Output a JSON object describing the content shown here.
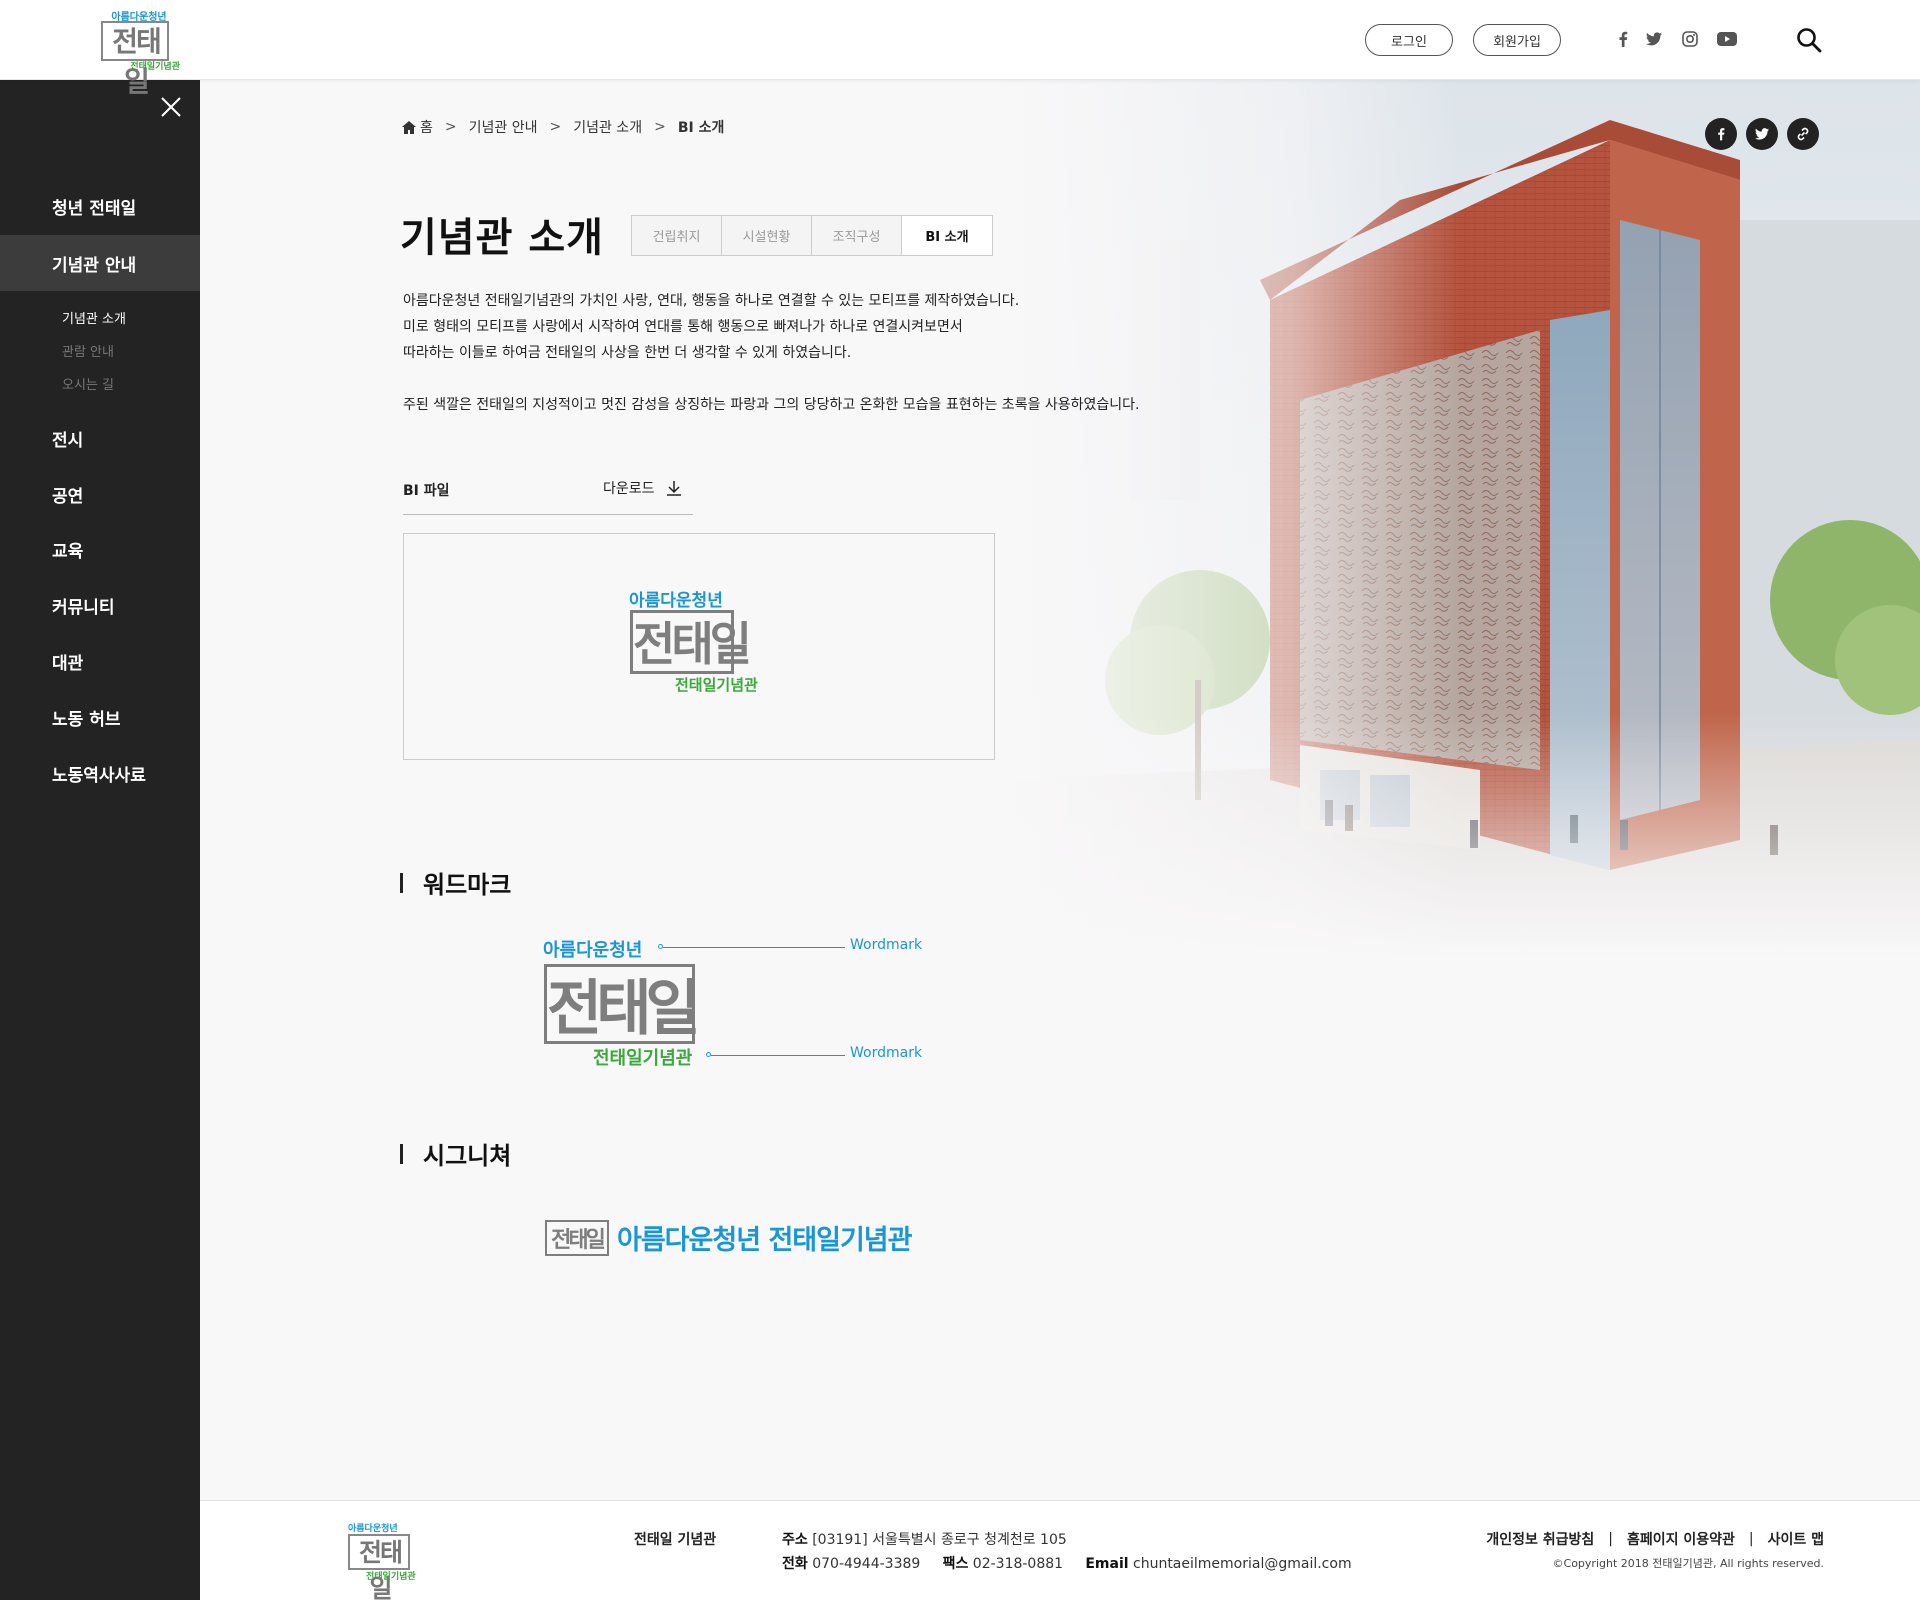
{
  "header": {
    "logo": {
      "top": "아름다운청년",
      "main": "전태일",
      "bottom": "전태일기념관"
    },
    "login_label": "로그인",
    "join_label": "회원가입",
    "sns": [
      "facebook-icon",
      "twitter-icon",
      "instagram-icon",
      "youtube-icon"
    ],
    "search_icon": "search-icon"
  },
  "sidebar": {
    "items": [
      {
        "label": "청년 전태일"
      },
      {
        "label": "기념관 안내"
      },
      {
        "label": "전시"
      },
      {
        "label": "공연"
      },
      {
        "label": "교육"
      },
      {
        "label": "커뮤니티"
      },
      {
        "label": "대관"
      },
      {
        "label": "노동 허브"
      },
      {
        "label": "노동역사사료"
      }
    ],
    "sub_items": [
      {
        "label": "기념관 소개"
      },
      {
        "label": "관람 안내"
      },
      {
        "label": "오시는 길"
      }
    ]
  },
  "breadcrumb": {
    "home": "홈",
    "sep": ">",
    "level1": "기념관 안내",
    "level2": "기념관 소개",
    "current": "BI 소개"
  },
  "page": {
    "title": "기념관 소개",
    "tabs": [
      {
        "label": "건립취지"
      },
      {
        "label": "시설현황"
      },
      {
        "label": "조직구성"
      },
      {
        "label": "BI 소개"
      }
    ],
    "desc": [
      "아름다운청년 전태일기념관의 가치인 사랑, 연대, 행동을 하나로 연결할 수 있는 모티프를 제작하였습니다.",
      "미로 형태의 모티프를 사랑에서 시작하여 연대를 통해 행동으로 빠져나가 하나로 연결시켜보면서",
      "따라하는 이들로 하여금 전태일의 사상을 한번 더 생각할 수 있게 하였습니다.",
      "주된 색깔은 전태일의 지성적이고 멋진 감성을 상징하는 파랑과 그의 당당하고 온화한 모습을 표현하는 초록을 사용하였습니다."
    ],
    "bi_file_label": "BI 파일",
    "download_label": "다운로드",
    "logo": {
      "top": "아름다운청년",
      "main": "전태일",
      "bottom": "전태일기념관"
    },
    "wordmark": {
      "title": "워드마크",
      "label1": "Wordmark",
      "label2": "Wordmark"
    },
    "signature": {
      "title": "시그니쳐",
      "box": "전태일",
      "text": "아름다운청년 전태일기념관"
    }
  },
  "footer": {
    "logo": {
      "top": "아름다운청년",
      "main": "전태일",
      "bottom": "전태일기념관"
    },
    "org": "전태일 기념관",
    "addr_label": "주소",
    "addr": "[03191] 서울특별시 종로구 청계천로 105",
    "tel_label": "전화",
    "tel": "070-4944-3389",
    "fax_label": "팩스",
    "fax": "02-318-0881",
    "email_label": "Email",
    "email": "chuntaeilmemorial@gmail.com",
    "links": [
      "개인정보 취급방침",
      "홈페이지 이용약관",
      "사이트 맵"
    ],
    "link_sep": "|",
    "copyright": "©Copyright 2018 전태일기념관, All rights reserved."
  },
  "colors": {
    "blue": "#1a96d4",
    "green": "#3aa83a",
    "sidebar": "#232323",
    "logo_gray": "#7e7e7e"
  }
}
